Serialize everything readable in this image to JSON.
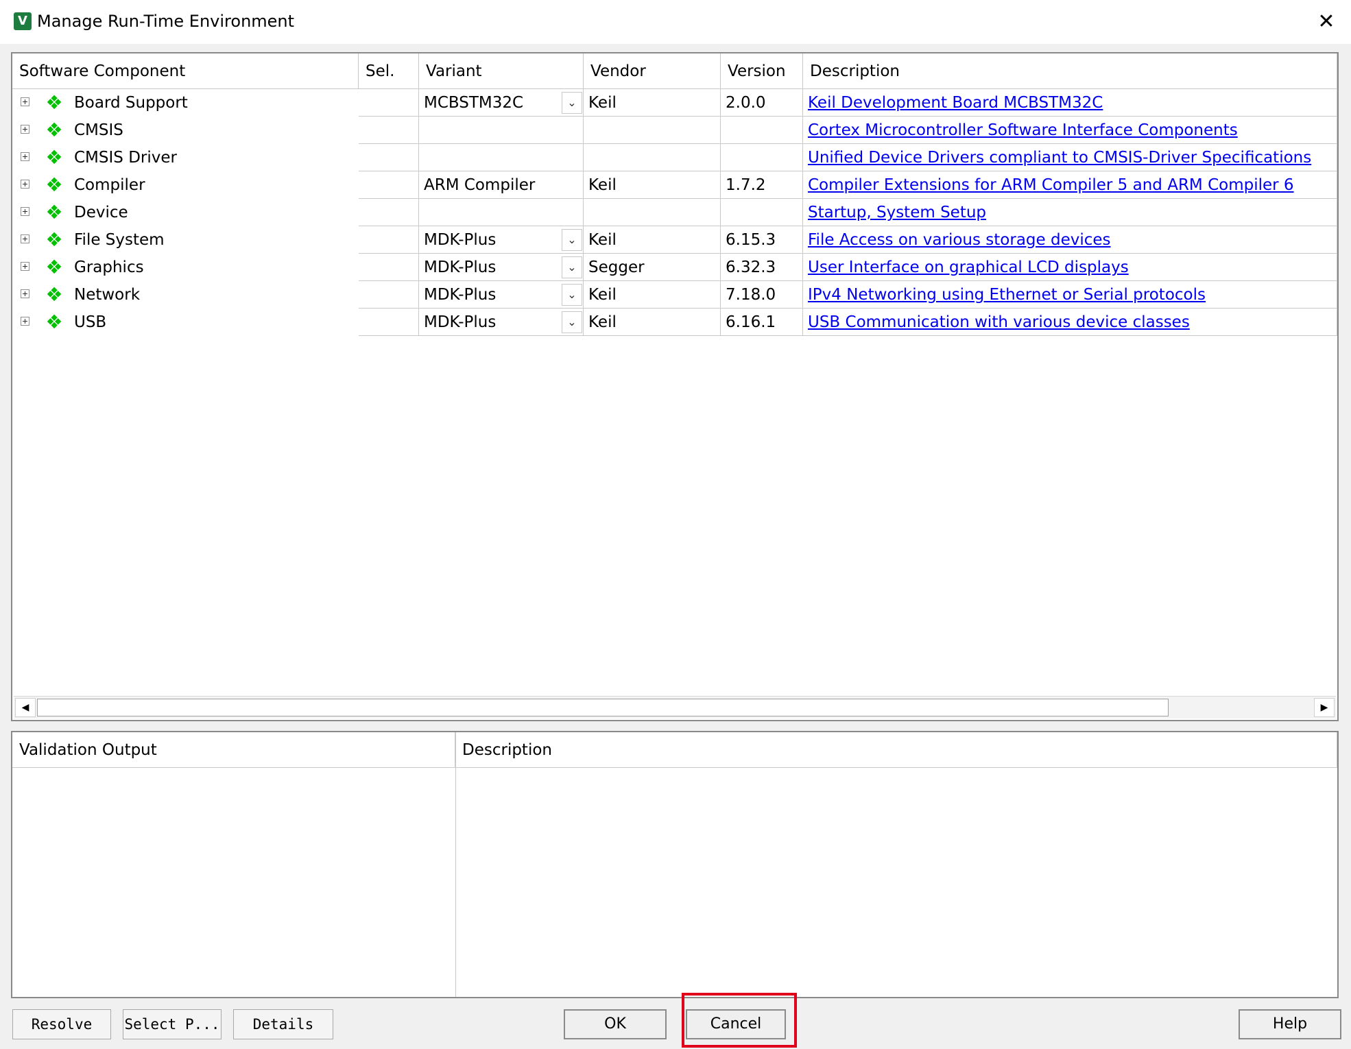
{
  "window": {
    "title": "Manage Run-Time Environment",
    "icon": "keil-uv-icon"
  },
  "components": {
    "columns": [
      "Software Component",
      "Sel.",
      "Variant",
      "Vendor",
      "Version",
      "Description"
    ],
    "rows": [
      {
        "name": "Board Support",
        "sel": "",
        "variant": "MCBSTM32C",
        "variant_dropdown": true,
        "vendor": "Keil",
        "version": "2.0.0",
        "description": "Keil Development Board MCBSTM32C"
      },
      {
        "name": "CMSIS",
        "sel": "",
        "variant": "",
        "variant_dropdown": false,
        "vendor": "",
        "version": "",
        "description": "Cortex Microcontroller Software Interface Components"
      },
      {
        "name": "CMSIS Driver",
        "sel": "",
        "variant": "",
        "variant_dropdown": false,
        "vendor": "",
        "version": "",
        "description": "Unified Device Drivers compliant to CMSIS-Driver Specifications"
      },
      {
        "name": "Compiler",
        "sel": "",
        "variant": "ARM Compiler",
        "variant_dropdown": false,
        "vendor": "Keil",
        "version": "1.7.2",
        "description": "Compiler Extensions for ARM Compiler 5 and ARM Compiler 6"
      },
      {
        "name": "Device",
        "sel": "",
        "variant": "",
        "variant_dropdown": false,
        "vendor": "",
        "version": "",
        "description": "Startup, System Setup"
      },
      {
        "name": "File System",
        "sel": "",
        "variant": "MDK-Plus",
        "variant_dropdown": true,
        "vendor": "Keil",
        "version": "6.15.3",
        "description": "File Access on various storage devices"
      },
      {
        "name": "Graphics",
        "sel": "",
        "variant": "MDK-Plus",
        "variant_dropdown": true,
        "vendor": "Segger",
        "version": "6.32.3",
        "description": "User Interface on graphical LCD displays"
      },
      {
        "name": "Network",
        "sel": "",
        "variant": "MDK-Plus",
        "variant_dropdown": true,
        "vendor": "Keil",
        "version": "7.18.0",
        "description": "IPv4 Networking using Ethernet or Serial protocols"
      },
      {
        "name": "USB",
        "sel": "",
        "variant": "MDK-Plus",
        "variant_dropdown": true,
        "vendor": "Keil",
        "version": "6.16.1",
        "description": "USB Communication with various device classes"
      }
    ]
  },
  "validation": {
    "columns": [
      "Validation Output",
      "Description"
    ]
  },
  "buttons": {
    "resolve": "Resolve",
    "select_packs": "Select P...",
    "details": "Details",
    "ok": "OK",
    "cancel": "Cancel",
    "help": "Help"
  },
  "colors": {
    "component_icon": "#00c000",
    "link": "#0000ee",
    "highlight": "#e0001c"
  }
}
